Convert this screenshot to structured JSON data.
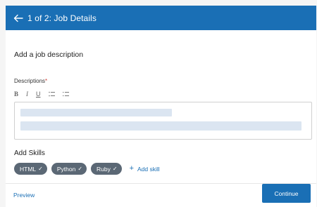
{
  "header": {
    "title": "1 of 2: Job Details",
    "back_icon": "arrow-left-icon"
  },
  "main": {
    "section_title": "Add a job description",
    "description_label": "Descriptions",
    "required_mark": "*",
    "toolbar": {
      "bold": "B",
      "italic": "I",
      "underline": "U",
      "bullet_list": "≔",
      "numbered_list": "≔"
    },
    "skills_title": "Add Skills",
    "skills": [
      {
        "label": "HTML"
      },
      {
        "label": "Python"
      },
      {
        "label": "Ruby"
      }
    ],
    "add_skill_label": "Add skill"
  },
  "footer": {
    "preview_label": "Preview",
    "continue_label": "Continue"
  },
  "colors": {
    "primary": "#1a6fb5",
    "chip": "#5b6875",
    "placeholder": "#dbe5f1"
  }
}
